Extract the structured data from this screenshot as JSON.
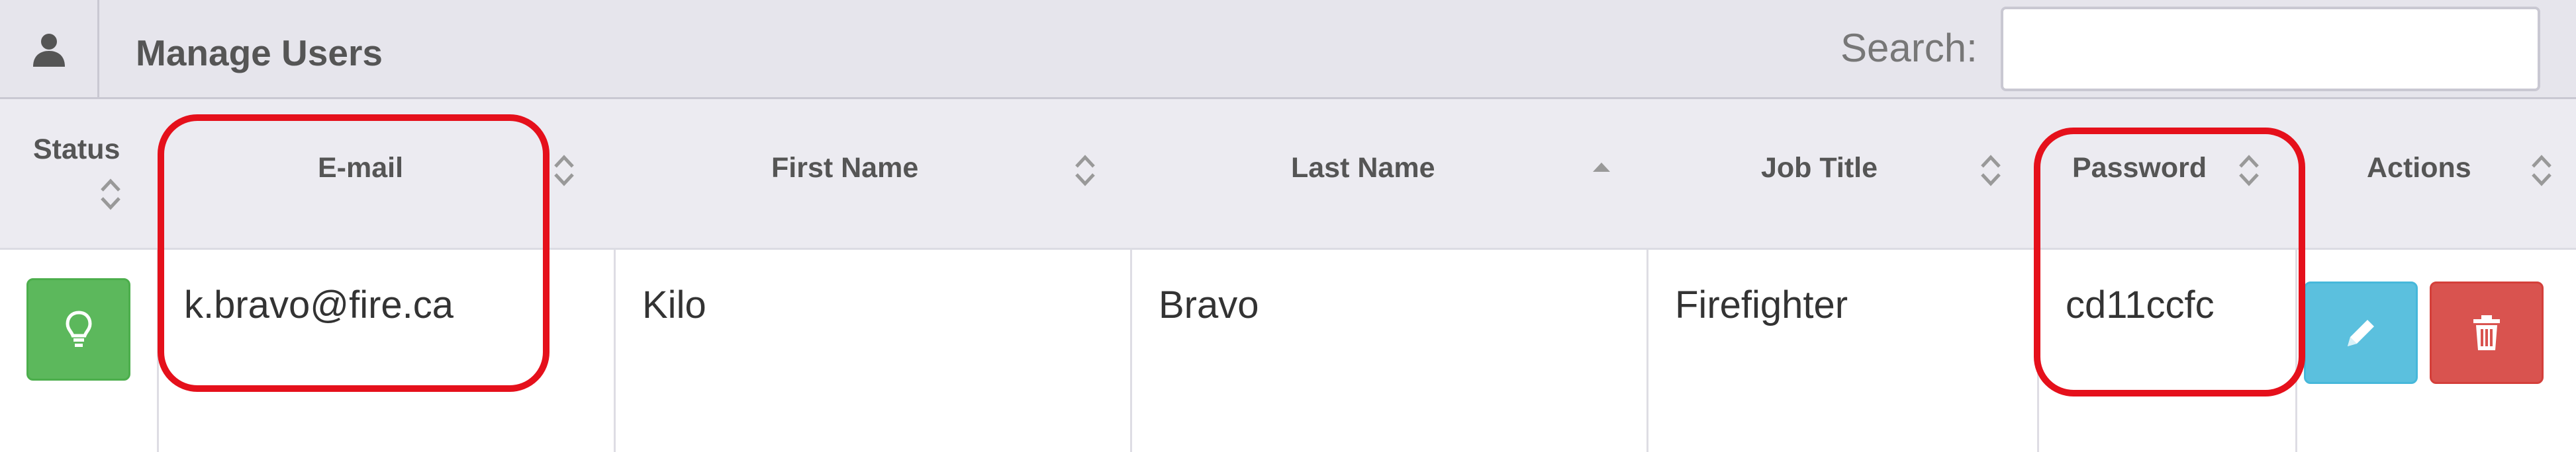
{
  "header": {
    "title": "Manage Users",
    "icon": "user-icon",
    "search_label": "Search:",
    "search_value": "",
    "search_placeholder": ""
  },
  "columns": [
    {
      "key": "status",
      "label": "Status",
      "sort": "both"
    },
    {
      "key": "email",
      "label": "E-mail",
      "sort": "both"
    },
    {
      "key": "first_name",
      "label": "First Name",
      "sort": "both"
    },
    {
      "key": "last_name",
      "label": "Last Name",
      "sort": "asc"
    },
    {
      "key": "job_title",
      "label": "Job Title",
      "sort": "both"
    },
    {
      "key": "password",
      "label": "Password",
      "sort": "both"
    },
    {
      "key": "actions",
      "label": "Actions",
      "sort": "both"
    }
  ],
  "rows": [
    {
      "status_icon": "lightbulb-icon",
      "email": "k.bravo@fire.ca",
      "first_name": "Kilo",
      "last_name": "Bravo",
      "job_title": "Firefighter",
      "password": "cd11ccfc",
      "edit_icon": "pencil-icon",
      "delete_icon": "trash-icon"
    }
  ],
  "colors": {
    "header_bg": "#e6e5ec",
    "status_green": "#5cb85c",
    "edit_blue": "#5bc0de",
    "delete_red": "#d9534f",
    "highlight_red": "#e5101b"
  }
}
